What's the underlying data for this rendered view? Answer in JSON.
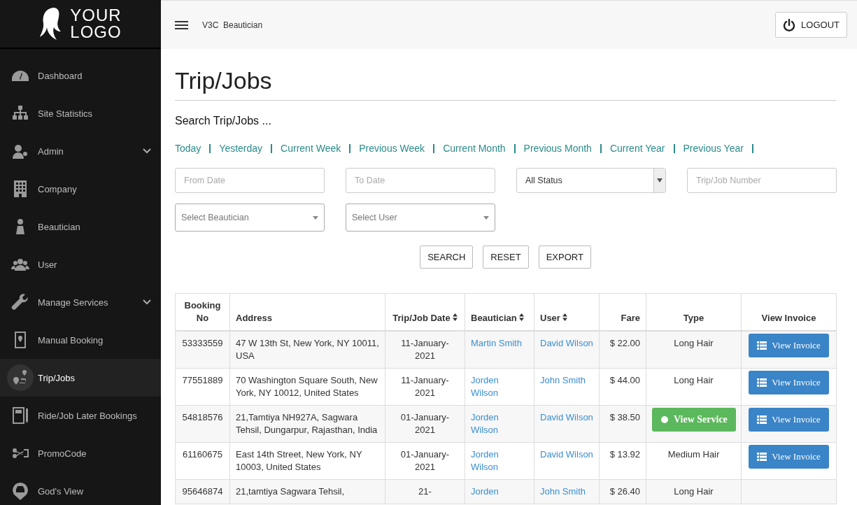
{
  "logo": {
    "line_1": "YOUR",
    "line_2": "LOGO"
  },
  "sidebar": {
    "items": [
      {
        "label": "Dashboard",
        "expandable": false,
        "selected": false
      },
      {
        "label": "Site Statistics",
        "expandable": false,
        "selected": false
      },
      {
        "label": "Admin",
        "expandable": true,
        "selected": false
      },
      {
        "label": "Company",
        "expandable": false,
        "selected": false
      },
      {
        "label": "Beautician",
        "expandable": false,
        "selected": false
      },
      {
        "label": "User",
        "expandable": false,
        "selected": false
      },
      {
        "label": "Manage Services",
        "expandable": true,
        "selected": false
      },
      {
        "label": "Manual Booking",
        "expandable": false,
        "selected": false
      },
      {
        "label": "Trip/Jobs",
        "expandable": false,
        "selected": true
      },
      {
        "label": "Ride/Job Later Bookings",
        "expandable": false,
        "selected": false
      },
      {
        "label": "PromoCode",
        "expandable": false,
        "selected": false
      },
      {
        "label": "God's View",
        "expandable": false,
        "selected": false
      }
    ]
  },
  "topbar": {
    "title": "V3C  Beautician",
    "logout": "LOGOUT"
  },
  "page_title": "Trip/Jobs",
  "search_heading": "Search Trip/Jobs ...",
  "period_links": [
    "Today",
    "Yesterday",
    "Current Week",
    "Previous Week",
    "Current Month",
    "Previous Month",
    "Current Year",
    "Previous Year"
  ],
  "filters": {
    "from_date": {
      "placeholder": "From Date"
    },
    "to_date": {
      "placeholder": "To Date"
    },
    "status": {
      "value": "All Status"
    },
    "job_number": {
      "placeholder": "Trip/Job Number"
    },
    "beautician": {
      "placeholder": "Select Beautician"
    },
    "user": {
      "placeholder": "Select User"
    }
  },
  "actions": [
    "SEARCH",
    "RESET",
    "EXPORT"
  ],
  "table": {
    "columns": [
      {
        "label": "Booking No",
        "sortable": false
      },
      {
        "label": "Address",
        "sortable": false
      },
      {
        "label": "Trip/Job Date",
        "sortable": true
      },
      {
        "label": "Beautician",
        "sortable": true
      },
      {
        "label": "User",
        "sortable": true
      },
      {
        "label": "Fare",
        "sortable": false
      },
      {
        "label": "Type",
        "sortable": false
      },
      {
        "label": "View Invoice",
        "sortable": false
      }
    ],
    "rows": [
      {
        "booking_no": "53333559",
        "address": "47 W 13th St, New York, NY 10011, USA",
        "date": "11-January-2021",
        "beautician": "Martin Smith",
        "user": "David Wilson",
        "fare": "$ 22.00",
        "type": {
          "kind": "text",
          "text": "Long Hair"
        },
        "invoice": "View Invoice"
      },
      {
        "booking_no": "77551889",
        "address": "70 Washington Square South, New York, NY 10012, United States",
        "date": "11-January-2021",
        "beautician": "Jorden Wilson",
        "user": "John Smith",
        "fare": "$ 44.00",
        "type": {
          "kind": "text",
          "text": "Long Hair"
        },
        "invoice": "View Invoice"
      },
      {
        "booking_no": "54818576",
        "address": "21,Tamtiya NH927A, Sagwara Tehsil, Dungarpur, Rajasthan, India",
        "date": "01-January-2021",
        "beautician": "Jorden Wilson",
        "user": "David Wilson",
        "fare": "$ 38.50",
        "type": {
          "kind": "button",
          "text": "View Service"
        },
        "invoice": "View Invoice"
      },
      {
        "booking_no": "61160675",
        "address": "East 14th Street, New York, NY 10003, United States",
        "date": "01-January-2021",
        "beautician": "Jorden Wilson",
        "user": "David Wilson",
        "fare": "$ 13.92",
        "type": {
          "kind": "text",
          "text": "Medium Hair"
        },
        "invoice": "View Invoice"
      },
      {
        "booking_no": "95646874",
        "address": "21,tamtiya Sagwara Tehsil,",
        "date": "21-",
        "beautician": "Jorden",
        "user": "John Smith",
        "fare": "$ 26.40",
        "type": {
          "kind": "text",
          "text": "Long Hair"
        }
      }
    ]
  }
}
